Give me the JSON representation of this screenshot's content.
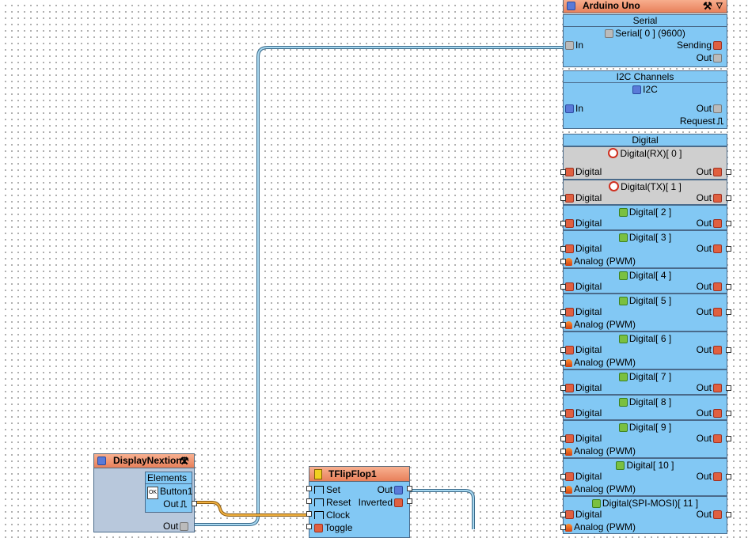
{
  "arduino": {
    "title": "Arduino Uno",
    "serial": {
      "header": "Serial",
      "sub": "Serial[ 0 ] (9600)",
      "in": "In",
      "sending": "Sending",
      "out": "Out"
    },
    "i2c": {
      "header": "I2C Channels",
      "sub": "I2C",
      "in": "In",
      "out": "Out",
      "request": "Request"
    },
    "digital_header": "Digital",
    "channels": [
      {
        "name": "Digital(RX)[ 0 ]",
        "disabled": true,
        "analog": false
      },
      {
        "name": "Digital(TX)[ 1 ]",
        "disabled": true,
        "analog": false
      },
      {
        "name": "Digital[ 2 ]",
        "disabled": false,
        "analog": false
      },
      {
        "name": "Digital[ 3 ]",
        "disabled": false,
        "analog": true
      },
      {
        "name": "Digital[ 4 ]",
        "disabled": false,
        "analog": false
      },
      {
        "name": "Digital[ 5 ]",
        "disabled": false,
        "analog": true
      },
      {
        "name": "Digital[ 6 ]",
        "disabled": false,
        "analog": true
      },
      {
        "name": "Digital[ 7 ]",
        "disabled": false,
        "analog": false
      },
      {
        "name": "Digital[ 8 ]",
        "disabled": false,
        "analog": false
      },
      {
        "name": "Digital[ 9 ]",
        "disabled": false,
        "analog": true
      },
      {
        "name": "Digital[ 10 ]",
        "disabled": false,
        "analog": true
      },
      {
        "name": "Digital(SPI-MOSI)[ 11 ]",
        "disabled": false,
        "analog": true
      }
    ],
    "pin_digital": "Digital",
    "pin_out": "Out",
    "pin_analog": "Analog (PWM)"
  },
  "display": {
    "title": "DisplayNextion1",
    "elements": "Elements",
    "button": "Button1",
    "btn_icon": "OK",
    "out": "Out",
    "out2": "Out"
  },
  "flipflop": {
    "title": "TFlipFlop1",
    "set": "Set",
    "reset": "Reset",
    "clock": "Clock",
    "toggle": "Toggle",
    "out": "Out",
    "inverted": "Inverted"
  },
  "colors": {
    "wire_blue": "#6aaed0",
    "wire_orange": "#d08a20",
    "block_blue": "#82c8f4",
    "title_orange": "#e8805a"
  }
}
